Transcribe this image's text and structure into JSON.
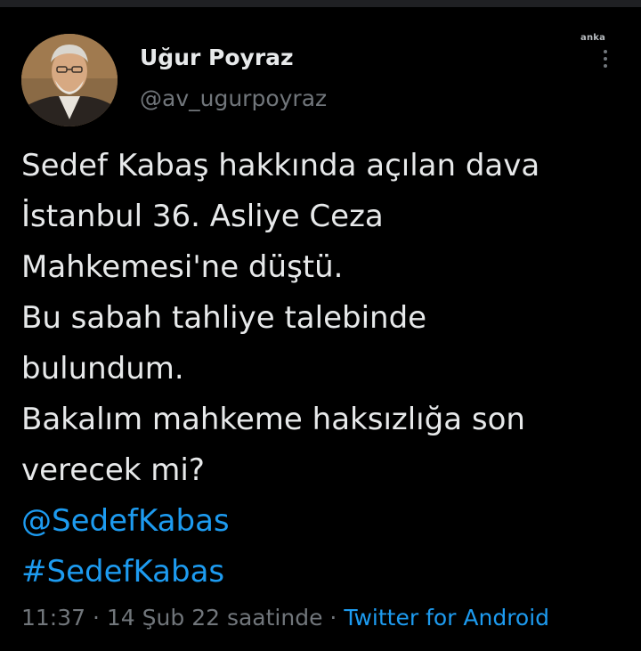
{
  "tweet": {
    "author": {
      "name": "Uğur Poyraz",
      "handle": "@av_ugurpoyraz"
    },
    "watermark": "anka",
    "text_lines": [
      "Sedef Kabaş hakkında açılan dava",
      "İstanbul 36. Asliye Ceza",
      "Mahkemesi'ne düştü.",
      "Bu sabah tahliye talebinde",
      "bulundum.",
      "Bakalım mahkeme haksızlığa son",
      "verecek mi?"
    ],
    "mention": "@SedefKabas",
    "hashtag": "#SedefKabas",
    "time": "11:37",
    "separator": "·",
    "date": "14 Şub 22 saatinde",
    "source": "Twitter for Android"
  },
  "icons": {
    "more": "more-vertical-icon",
    "avatar": "avatar-photo"
  },
  "colors": {
    "background": "#000000",
    "text": "#e7e9ea",
    "muted": "#71767b",
    "link": "#1d9bf0"
  }
}
